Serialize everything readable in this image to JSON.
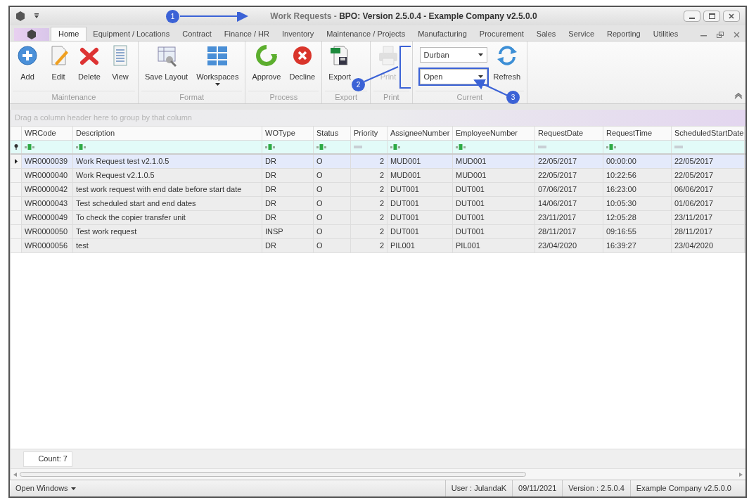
{
  "window": {
    "title": "Work Requests - **BPO: Version 2.5.0.4 - Example Company v2.5.0.0**"
  },
  "tabs": [
    {
      "label": "Home",
      "selected": true
    },
    {
      "label": "Equipment / Locations",
      "selected": false
    },
    {
      "label": "Contract",
      "selected": false
    },
    {
      "label": "Finance / HR",
      "selected": false
    },
    {
      "label": "Inventory",
      "selected": false
    },
    {
      "label": "Maintenance / Projects",
      "selected": false
    },
    {
      "label": "Manufacturing",
      "selected": false
    },
    {
      "label": "Procurement",
      "selected": false
    },
    {
      "label": "Sales",
      "selected": false
    },
    {
      "label": "Service",
      "selected": false
    },
    {
      "label": "Reporting",
      "selected": false
    },
    {
      "label": "Utilities",
      "selected": false
    }
  ],
  "ribbon": [
    {
      "label": "Maintenance",
      "items": [
        {
          "kind": "add",
          "label": "Add",
          "disabled": false
        },
        {
          "kind": "edit",
          "label": "Edit",
          "disabled": false
        },
        {
          "kind": "delete",
          "label": "Delete",
          "disabled": false
        },
        {
          "kind": "view",
          "label": "View",
          "disabled": false
        }
      ]
    },
    {
      "label": "Format",
      "items": [
        {
          "kind": "layout",
          "label": "Save Layout",
          "disabled": false
        },
        {
          "kind": "workspaces",
          "label": "Workspaces",
          "disabled": false
        }
      ]
    },
    {
      "label": "Process",
      "items": [
        {
          "kind": "approve",
          "label": "Approve",
          "disabled": false
        },
        {
          "kind": "decline",
          "label": "Decline",
          "disabled": false
        }
      ]
    },
    {
      "label": "Export",
      "items": [
        {
          "kind": "export",
          "label": "Export",
          "disabled": false
        }
      ]
    },
    {
      "label": "Print",
      "items": [
        {
          "kind": "print",
          "label": "Print",
          "disabled": true
        }
      ]
    },
    {
      "label": "Current",
      "items": [
        {
          "kind": "combos",
          "values": [
            "Durban",
            "Open"
          ]
        },
        {
          "kind": "refresh",
          "label": "Refresh",
          "disabled": false
        }
      ]
    }
  ],
  "group_panel": {
    "placeholder": "Drag a column header here to group by that column"
  },
  "table": {
    "columns": [
      {
        "label": "WRCode",
        "kind": "text"
      },
      {
        "label": "Description",
        "kind": "text"
      },
      {
        "label": "WOType",
        "kind": "text"
      },
      {
        "label": "Status",
        "kind": "text"
      },
      {
        "label": "Priority",
        "kind": "value"
      },
      {
        "label": "AssigneeNumber",
        "kind": "text"
      },
      {
        "label": "EmployeeNumber",
        "kind": "text"
      },
      {
        "label": "RequestDate",
        "kind": "value"
      },
      {
        "label": "RequestTime",
        "kind": "text"
      },
      {
        "label": "ScheduledStartDate",
        "kind": "value"
      }
    ],
    "rows": [
      {
        "selected": true,
        "cells": [
          "WR0000039",
          "Work Request test v2.1.0.5",
          "DR",
          "O",
          "2",
          "MUD001",
          "MUD001",
          "22/05/2017",
          "00:00:00",
          "22/05/2017"
        ]
      },
      {
        "selected": false,
        "cells": [
          "WR0000040",
          "Work Request v2.1.0.5",
          "DR",
          "O",
          "2",
          "MUD001",
          "MUD001",
          "22/05/2017",
          "10:22:56",
          "22/05/2017"
        ]
      },
      {
        "selected": false,
        "cells": [
          "WR0000042",
          "test work request with end date before start date",
          "DR",
          "O",
          "2",
          "DUT001",
          "DUT001",
          "07/06/2017",
          "16:23:00",
          "06/06/2017"
        ]
      },
      {
        "selected": false,
        "cells": [
          "WR0000043",
          "Test scheduled start and end dates",
          "DR",
          "O",
          "2",
          "DUT001",
          "DUT001",
          "14/06/2017",
          "10:05:30",
          "01/06/2017"
        ]
      },
      {
        "selected": false,
        "cells": [
          "WR0000049",
          "To check the copier transfer unit",
          "DR",
          "O",
          "2",
          "DUT001",
          "DUT001",
          "23/11/2017",
          "12:05:28",
          "23/11/2017"
        ]
      },
      {
        "selected": false,
        "cells": [
          "WR0000050",
          "Test work request",
          "INSP",
          "O",
          "2",
          "DUT001",
          "DUT001",
          "28/11/2017",
          "09:16:55",
          "28/11/2017"
        ]
      },
      {
        "selected": false,
        "cells": [
          "WR0000056",
          "test",
          "DR",
          "O",
          "2",
          "PIL001",
          "PIL001",
          "23/04/2020",
          "16:39:27",
          "23/04/2020"
        ]
      }
    ],
    "footer": "Count: 7"
  },
  "status_bar": {
    "menu": "Open Windows",
    "items": [
      "User : JulandaK",
      "09/11/2021",
      "Version : 2.5.0.4",
      "Example Company v2.5.0.0"
    ]
  },
  "callouts": [
    "1",
    "2",
    "3"
  ]
}
